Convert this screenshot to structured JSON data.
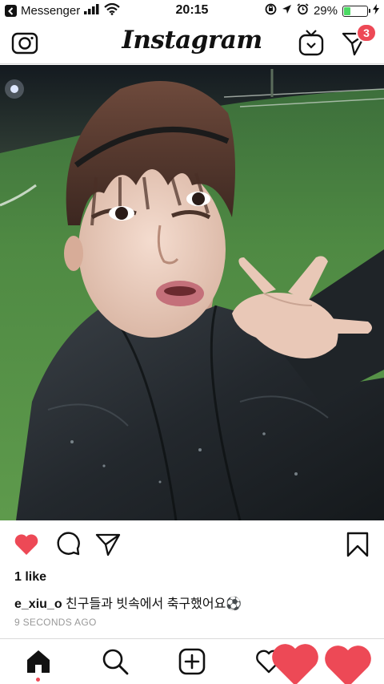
{
  "status_bar": {
    "back_app": "Messenger",
    "time": "20:15",
    "battery": "29%",
    "battery_level": 0.29
  },
  "header": {
    "logo": "Instagram",
    "direct_badge": "3"
  },
  "post": {
    "likes": "1 like",
    "username": "e_xiu_o",
    "caption": "친구들과 빗속에서 축구했어요⚽️",
    "timestamp": "9 SECONDS AGO",
    "liked": true
  },
  "icons": {
    "camera": "camera-icon",
    "igtv": "igtv-icon",
    "direct": "paper-plane-icon",
    "like": "heart-icon",
    "comment": "comment-icon",
    "share": "share-icon",
    "save": "bookmark-icon",
    "home": "home-icon",
    "search": "search-icon",
    "new_post": "plus-square-icon",
    "activity": "heart-outline-icon"
  },
  "colors": {
    "like_red": "#ed4956",
    "battery_green": "#4cd964",
    "muted_text": "#999999"
  }
}
